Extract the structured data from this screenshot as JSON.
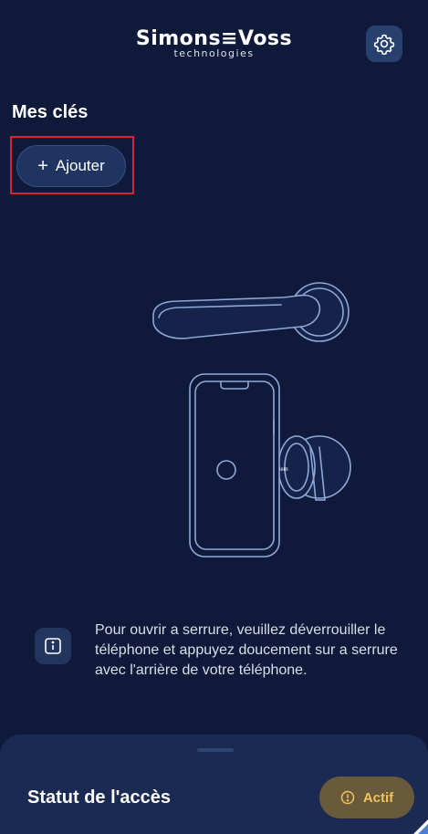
{
  "header": {
    "brand_main": "Simons≡Voss",
    "brand_sub": "technologies",
    "settings_icon": "gear-icon"
  },
  "keys": {
    "title": "Mes clés",
    "add_plus": "+",
    "add_label": "Ajouter"
  },
  "info": {
    "icon": "info-icon",
    "text": "Pour ouvrir a serrure, veuillez déverrouiller le téléphone et appuyez doucement sur a serrure avec l'arrière de votre téléphone."
  },
  "status": {
    "title": "Statut de l'accès",
    "badge_label": "Actif",
    "badge_icon": "alert-circle-icon"
  },
  "colors": {
    "background": "#0f1a3a",
    "panel": "#1b2a52",
    "accent_button": "#1f3461",
    "badge_bg": "#6a5a3c",
    "badge_text": "#f2c260",
    "highlight_border": "#d8242f"
  }
}
